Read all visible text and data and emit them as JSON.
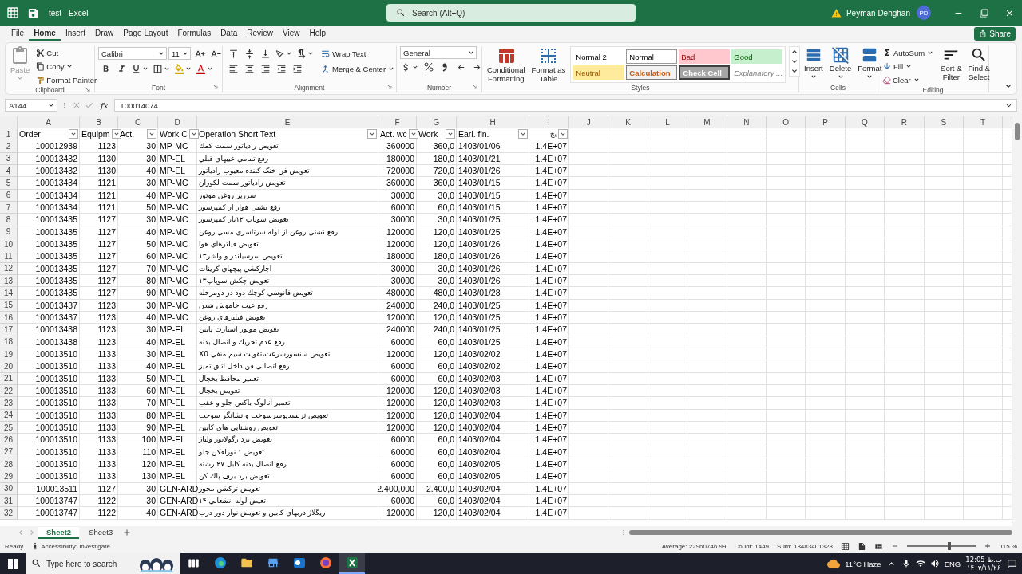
{
  "title_bar": {
    "title": "test - Excel",
    "search_placeholder": "Search (Alt+Q)",
    "user": "Peyman Dehghan",
    "avatar": "PD"
  },
  "ribbon_tabs": [
    {
      "label": "File",
      "selected": false
    },
    {
      "label": "Home",
      "selected": true
    },
    {
      "label": "Insert",
      "selected": false
    },
    {
      "label": "Draw",
      "selected": false
    },
    {
      "label": "Page Layout",
      "selected": false
    },
    {
      "label": "Formulas",
      "selected": false
    },
    {
      "label": "Data",
      "selected": false
    },
    {
      "label": "Review",
      "selected": false
    },
    {
      "label": "View",
      "selected": false
    },
    {
      "label": "Help",
      "selected": false
    }
  ],
  "share": "Share",
  "ribbon": {
    "clipboard": {
      "paste": {
        "label": "Paste",
        "disabled": true
      },
      "cut": "Cut",
      "copy": "Copy",
      "format_painter": "Format Painter",
      "label": "Clipboard"
    },
    "font": {
      "name": "Calibri",
      "size": "11",
      "label": "Font"
    },
    "alignment": {
      "wrap": "Wrap Text",
      "merge": "Merge & Center",
      "label": "Alignment"
    },
    "number": {
      "format": "General",
      "label": "Number"
    },
    "styles": {
      "conditional": [
        "Conditional",
        "Formatting"
      ],
      "format_table": [
        "Format as",
        "Table"
      ],
      "cell_styles": [
        {
          "label": "Normal 2",
          "kind": "plain"
        },
        {
          "label": "Normal",
          "kind": "framed"
        },
        {
          "label": "Bad",
          "kind": "bad"
        },
        {
          "label": "Good",
          "kind": "good"
        },
        {
          "label": "Neutral",
          "kind": "neutral"
        },
        {
          "label": "Calculation",
          "kind": "calculation"
        },
        {
          "label": "Check Cell",
          "kind": "check"
        },
        {
          "label": "Explanatory ...",
          "kind": "explanatory"
        }
      ],
      "label": "Styles"
    },
    "cells": {
      "buttons": [
        "Insert",
        "Delete",
        "Format"
      ],
      "label": "Cells"
    },
    "editing": {
      "autosum": "AutoSum",
      "fill": "Fill",
      "clear": "Clear",
      "sort": [
        "Sort &",
        "Filter"
      ],
      "find": [
        "Find &",
        "Select"
      ],
      "label": "Editing"
    }
  },
  "formula_bar": {
    "name_box": "A144",
    "function_label": "fx",
    "value": "100014074"
  },
  "sheet": {
    "columns": [
      "A",
      "B",
      "C",
      "D",
      "E",
      "F",
      "G",
      "H",
      "I",
      "J",
      "K",
      "L",
      "M",
      "N",
      "O",
      "P",
      "Q",
      "R",
      "S",
      "T"
    ],
    "header": {
      "num": "1",
      "cells": [
        "Order",
        "Equipm",
        "Act.",
        "Work C",
        "Operation Short Text",
        "Act. wc",
        "Work",
        "Earl. fin.",
        "يخ"
      ]
    },
    "rows": [
      {
        "num": "2",
        "cells": [
          "100012939",
          "1123",
          "30",
          "MP-MC",
          "تعويض رادياتور سمت كمك",
          "360000",
          "360,0",
          "1403/01/06",
          "1.4E+07"
        ]
      },
      {
        "num": "3",
        "cells": [
          "100013432",
          "1130",
          "30",
          "MP-EL",
          "رفع تمامي عيبهاي قبلي",
          "180000",
          "180,0",
          "1403/01/21",
          "1.4E+07"
        ]
      },
      {
        "num": "4",
        "cells": [
          "100013432",
          "1130",
          "40",
          "MP-EL",
          "تعويض فن خنک کننده معيوب رادياتور",
          "720000",
          "720,0",
          "1403/01/26",
          "1.4E+07"
        ]
      },
      {
        "num": "5",
        "cells": [
          "100013434",
          "1121",
          "30",
          "MP-MC",
          "تعويض رادياتور سمت لكوران",
          "360000",
          "360,0",
          "1403/01/15",
          "1.4E+07"
        ]
      },
      {
        "num": "6",
        "cells": [
          "100013434",
          "1121",
          "40",
          "MP-MC",
          "سرريز روغن موتور",
          "30000",
          "30,0",
          "1403/01/15",
          "1.4E+07"
        ]
      },
      {
        "num": "7",
        "cells": [
          "100013434",
          "1121",
          "50",
          "MP-MC",
          "رفع نشتي هوار از كمپرسور",
          "60000",
          "60,0",
          "1403/01/15",
          "1.4E+07"
        ]
      },
      {
        "num": "8",
        "cells": [
          "100013435",
          "1127",
          "30",
          "MP-MC",
          "تعويض سوپاپ ۱۲بار كمپرسور",
          "30000",
          "30,0",
          "1403/01/25",
          "1.4E+07"
        ]
      },
      {
        "num": "9",
        "cells": [
          "100013435",
          "1127",
          "40",
          "MP-MC",
          "رفع نشتي روغن از لوله سرتاسري مسي روغن",
          "120000",
          "120,0",
          "1403/01/25",
          "1.4E+07"
        ]
      },
      {
        "num": "10",
        "cells": [
          "100013435",
          "1127",
          "50",
          "MP-MC",
          "تعويض فيلترهاي هوا",
          "120000",
          "120,0",
          "1403/01/26",
          "1.4E+07"
        ]
      },
      {
        "num": "11",
        "cells": [
          "100013435",
          "1127",
          "60",
          "MP-MC",
          "تعويض سرسيلندر و واشر۱۳",
          "180000",
          "180,0",
          "1403/01/26",
          "1.4E+07"
        ]
      },
      {
        "num": "12",
        "cells": [
          "100013435",
          "1127",
          "70",
          "MP-MC",
          "آچاركشي پيچهاي كرينات",
          "30000",
          "30,0",
          "1403/01/26",
          "1.4E+07"
        ]
      },
      {
        "num": "13",
        "cells": [
          "100013435",
          "1127",
          "80",
          "MP-MC",
          "تعويض چكش سوپاپ۱۳",
          "30000",
          "30,0",
          "1403/01/26",
          "1.4E+07"
        ]
      },
      {
        "num": "14",
        "cells": [
          "100013435",
          "1127",
          "90",
          "MP-MC",
          "تعويض فانوسي كوچك دود در دومرحله",
          "480000",
          "480,0",
          "1403/01/28",
          "1.4E+07"
        ]
      },
      {
        "num": "15",
        "cells": [
          "100013437",
          "1123",
          "30",
          "MP-MC",
          "رفع عيب خاموش شدن",
          "240000",
          "240,0",
          "1403/01/25",
          "1.4E+07"
        ]
      },
      {
        "num": "16",
        "cells": [
          "100013437",
          "1123",
          "40",
          "MP-MC",
          "تعويض فيلترهاي روغن",
          "120000",
          "120,0",
          "1403/01/25",
          "1.4E+07"
        ]
      },
      {
        "num": "17",
        "cells": [
          "100013438",
          "1123",
          "30",
          "MP-EL",
          "تعويض موتور استارت پايين",
          "240000",
          "240,0",
          "1403/01/25",
          "1.4E+07"
        ]
      },
      {
        "num": "18",
        "cells": [
          "100013438",
          "1123",
          "40",
          "MP-EL",
          "رفع عدم تحريك و اتصال بدنه",
          "60000",
          "60,0",
          "1403/01/25",
          "1.4E+07"
        ]
      },
      {
        "num": "19",
        "cells": [
          "100013510",
          "1133",
          "30",
          "MP-EL",
          "تعويض سنسورسرعت،تقويت سيم منفي X0",
          "120000",
          "120,0",
          "1403/02/02",
          "1.4E+07"
        ]
      },
      {
        "num": "20",
        "cells": [
          "100013510",
          "1133",
          "40",
          "MP-EL",
          "رفع اتصالي فن داخل اتاق تميز",
          "60000",
          "60,0",
          "1403/02/02",
          "1.4E+07"
        ]
      },
      {
        "num": "21",
        "cells": [
          "100013510",
          "1133",
          "50",
          "MP-EL",
          "تعمير محافظ يخچال",
          "60000",
          "60,0",
          "1403/02/03",
          "1.4E+07"
        ]
      },
      {
        "num": "22",
        "cells": [
          "100013510",
          "1133",
          "60",
          "MP-EL",
          "تعويض يخچال",
          "120000",
          "120,0",
          "1403/02/03",
          "1.4E+07"
        ]
      },
      {
        "num": "23",
        "cells": [
          "100013510",
          "1133",
          "70",
          "MP-EL",
          "تعمير آنالوگ باكس جلو و عقب",
          "120000",
          "120,0",
          "1403/02/03",
          "1.4E+07"
        ]
      },
      {
        "num": "24",
        "cells": [
          "100013510",
          "1133",
          "80",
          "MP-EL",
          "تعويض ترنسديوسرسوخت و نشانگر سوخت",
          "120000",
          "120,0",
          "1403/02/04",
          "1.4E+07"
        ]
      },
      {
        "num": "25",
        "cells": [
          "100013510",
          "1133",
          "90",
          "MP-EL",
          "تعويض روشنايي هاي كابين",
          "120000",
          "120,0",
          "1403/02/04",
          "1.4E+07"
        ]
      },
      {
        "num": "26",
        "cells": [
          "100013510",
          "1133",
          "100",
          "MP-EL",
          "تعويض برد رگولاتور ولتاژ",
          "60000",
          "60,0",
          "1403/02/04",
          "1.4E+07"
        ]
      },
      {
        "num": "27",
        "cells": [
          "100013510",
          "1133",
          "110",
          "MP-EL",
          "تعويض ۱ نورافكن جلو",
          "60000",
          "60,0",
          "1403/02/04",
          "1.4E+07"
        ]
      },
      {
        "num": "28",
        "cells": [
          "100013510",
          "1133",
          "120",
          "MP-EL",
          "رفع اتصال بدنه كابل ۲۷ رشته",
          "60000",
          "60,0",
          "1403/02/05",
          "1.4E+07"
        ]
      },
      {
        "num": "29",
        "cells": [
          "100013510",
          "1133",
          "130",
          "MP-EL",
          "تعويض برد برف پاك كن",
          "60000",
          "60,0",
          "1403/02/05",
          "1.4E+07"
        ]
      },
      {
        "num": "30",
        "cells": [
          "100013511",
          "1127",
          "30",
          "GEN-ARD",
          "تعويض تركشن محور",
          "2.400,000",
          "2.400,0",
          "1403/02/04",
          "1.4E+07"
        ]
      },
      {
        "num": "31",
        "cells": [
          "100013747",
          "1122",
          "30",
          "GEN-ARD",
          "تعيض لوله انشعابي ۱۴",
          "60000",
          "60,0",
          "1403/02/04",
          "1.4E+07"
        ]
      },
      {
        "num": "32",
        "cells": [
          "100013747",
          "1122",
          "40",
          "GEN-ARD",
          "ريگلاژ دربهاي كابين و تعويض نوار دور درب",
          "120000",
          "120,0",
          "1403/02/04",
          "1.4E+07"
        ]
      }
    ]
  },
  "sheet_tabs": [
    {
      "label": "Sheet2",
      "selected": true
    },
    {
      "label": "Sheet3",
      "selected": false
    }
  ],
  "status_bar": {
    "ready": "Ready",
    "accessibility": "Accessibility: Investigate",
    "average": "Average: 22960746.99",
    "count": "Count: 1449",
    "sum": "Sum: 18483401328",
    "zoom": "115 %",
    "zoom_slider": {
      "level": 0.62
    }
  },
  "taskbar": {
    "search_placeholder": "Type here to search",
    "weather": "11°C Haze",
    "language": "ENG",
    "time": "12:05 ب.ظ",
    "date": "۱۴۰۳/۱۱/۲۶"
  }
}
